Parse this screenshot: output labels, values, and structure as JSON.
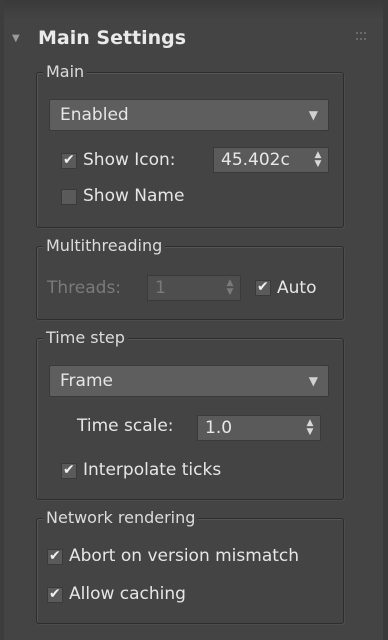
{
  "panel": {
    "title": "Main Settings",
    "icons": {
      "collapse": "triangle-down-icon",
      "grip": "grip-dots-icon"
    }
  },
  "main_group": {
    "label": "Main",
    "mode_dropdown": {
      "value": "Enabled"
    },
    "show_icon": {
      "label": "Show Icon:",
      "checked": true,
      "value": "45.402c"
    },
    "show_name": {
      "label": "Show Name",
      "checked": false
    }
  },
  "multithreading_group": {
    "label": "Multithreading",
    "threads": {
      "label": "Threads:",
      "value": "1",
      "disabled": true
    },
    "auto": {
      "label": "Auto",
      "checked": true
    }
  },
  "time_step_group": {
    "label": "Time step",
    "step_dropdown": {
      "value": "Frame"
    },
    "time_scale": {
      "label": "Time scale:",
      "value": "1.0"
    },
    "interpolate_ticks": {
      "label": "Interpolate ticks",
      "checked": true
    }
  },
  "network_group": {
    "label": "Network rendering",
    "abort_on_mismatch": {
      "label": "Abort on version mismatch",
      "checked": true
    },
    "allow_caching": {
      "label": "Allow caching",
      "checked": true
    }
  },
  "glyphs": {
    "check": "✔",
    "dropdown_arrow": "▼",
    "spin_up": "▲",
    "spin_down": "▼"
  }
}
